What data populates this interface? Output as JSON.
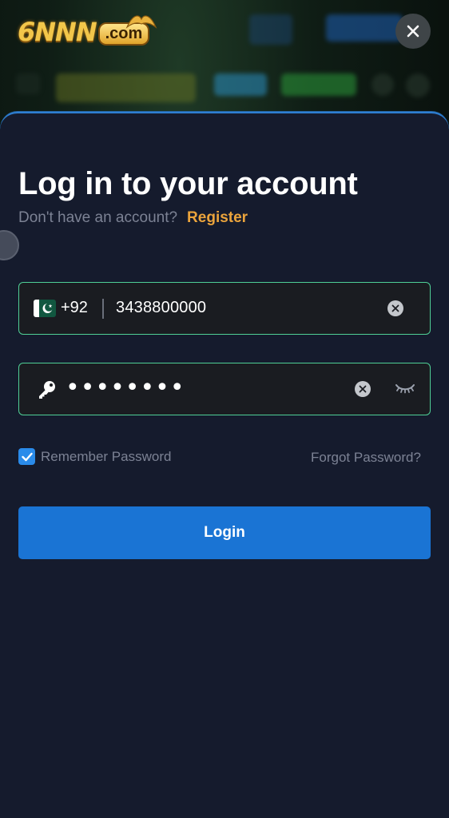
{
  "header": {
    "logo_text": "6NNN",
    "logo_suffix": ".com",
    "close_icon": "close-icon"
  },
  "login": {
    "title": "Log in to your account",
    "no_account_text": "Don't have an account?",
    "register_label": "Register",
    "phone": {
      "country_flag": "pakistan-flag-icon",
      "country_code": "+92",
      "value": "3438800000"
    },
    "password": {
      "masked_value": "••••••••",
      "key_icon": "key-icon",
      "visibility_icon": "eye-closed-icon"
    },
    "remember_label": "Remember Password",
    "remember_checked": true,
    "forgot_label": "Forgot Password?",
    "login_label": "Login"
  },
  "colors": {
    "accent_blue": "#1a74d4",
    "register_orange": "#eba43c",
    "field_border_green": "#4fcf96",
    "sheet_bg": "#151b2d"
  }
}
